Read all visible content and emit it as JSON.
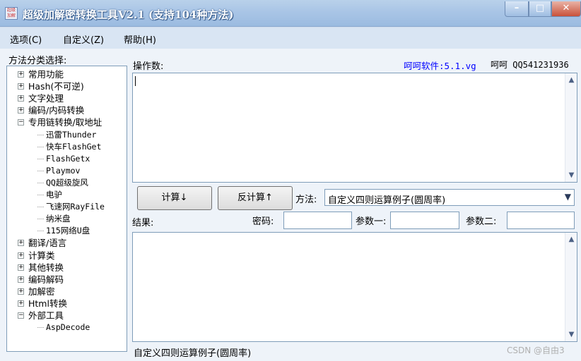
{
  "window": {
    "icon_text": "超级加解",
    "title": "超级加解密转换工具V2.1 (支持104种方法)",
    "buttons": {
      "minimize": "–",
      "maximize": "□",
      "close": "✕"
    }
  },
  "menu": [
    {
      "label": "选项(C)"
    },
    {
      "label": "自定义(Z)"
    },
    {
      "label": "帮助(H)"
    }
  ],
  "sidebar": {
    "title": "方法分类选择:",
    "tree": [
      {
        "label": "常用功能",
        "expanded": false
      },
      {
        "label": "Hash(不可逆)",
        "expanded": false
      },
      {
        "label": "文字处理",
        "expanded": false
      },
      {
        "label": "编码/内码转换",
        "expanded": false
      },
      {
        "label": "专用链转换/取地址",
        "expanded": true
      },
      {
        "label": "迅雷Thunder",
        "child": true
      },
      {
        "label": "快车FlashGet",
        "child": true
      },
      {
        "label": "FlashGetx",
        "child": true
      },
      {
        "label": "Playmov",
        "child": true
      },
      {
        "label": "QQ超级旋风",
        "child": true
      },
      {
        "label": "电驴",
        "child": true
      },
      {
        "label": "飞速网RayFile",
        "child": true
      },
      {
        "label": "纳米盘",
        "child": true
      },
      {
        "label": "115网络U盘",
        "child": true
      },
      {
        "label": "翻译/语言",
        "expanded": false
      },
      {
        "label": "计算类",
        "expanded": false
      },
      {
        "label": "其他转换",
        "expanded": false
      },
      {
        "label": "编码解码",
        "expanded": false
      },
      {
        "label": "加解密",
        "expanded": false
      },
      {
        "label": "Html转换",
        "expanded": false
      },
      {
        "label": "外部工具",
        "expanded": true
      },
      {
        "label": "AspDecode",
        "child": true
      }
    ]
  },
  "main": {
    "operand_label": "操作数:",
    "link_text": "呵呵软件:5.1.vg",
    "contact_text": "呵呵 QQ541231936",
    "input_value": "",
    "compute_button": "计算↓",
    "reverse_button": "反计算↑",
    "method_label": "方法:",
    "method_value": "自定义四则运算例子(圆周率)",
    "result_label": "结果:",
    "password_label": "密码:",
    "param1_label": "参数一:",
    "param2_label": "参数二:",
    "password_value": "",
    "param1_value": "",
    "param2_value": "",
    "result_value": "",
    "status_text": "自定义四则运算例子(圆周率)"
  },
  "watermark": "CSDN @自由3"
}
